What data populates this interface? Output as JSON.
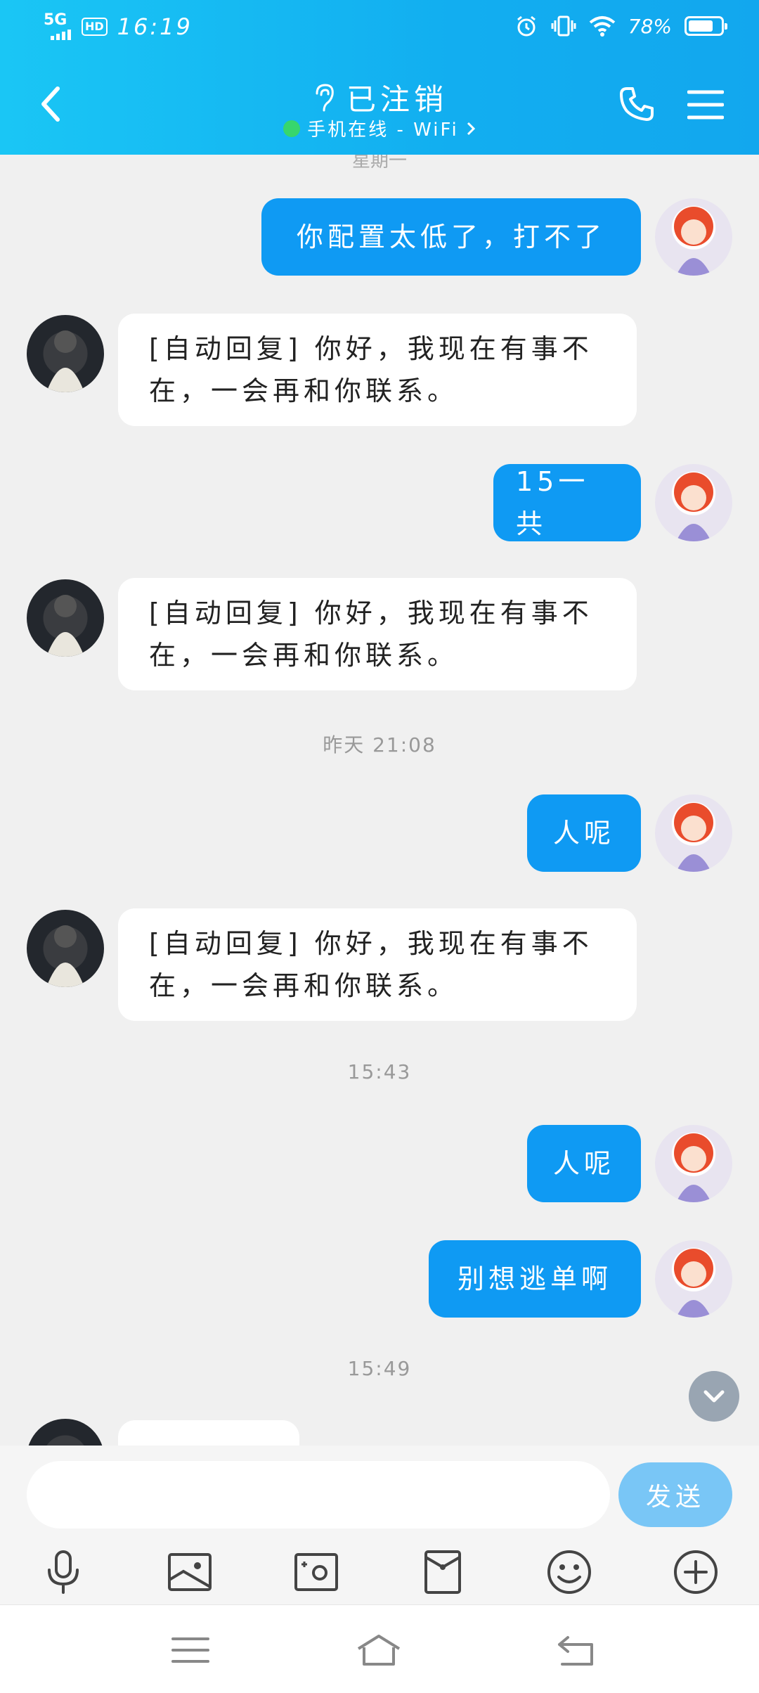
{
  "status_bar": {
    "network": "5G",
    "hd": "HD",
    "time": "16:19",
    "battery": "78%",
    "battery_level": 0.78
  },
  "header": {
    "title": "已注销",
    "subtitle": "手机在线 - WiFi"
  },
  "chat": {
    "partial_timestamp": "星期一",
    "messages": [
      {
        "sender": "me",
        "text": "你配置太低了，打不了"
      },
      {
        "sender": "other",
        "text": "[自动回复] 你好，我现在有事不在，一会再和你联系。"
      },
      {
        "sender": "me",
        "text": "15一共"
      },
      {
        "sender": "other",
        "text": "[自动回复] 你好，我现在有事不在，一会再和你联系。"
      },
      {
        "type": "timestamp",
        "text": "昨天 21:08"
      },
      {
        "sender": "me",
        "text": "人呢"
      },
      {
        "sender": "other",
        "text": "[自动回复] 你好，我现在有事不在，一会再和你联系。"
      },
      {
        "type": "timestamp",
        "text": "15:43"
      },
      {
        "sender": "me",
        "text": "人呢"
      },
      {
        "sender": "me",
        "text": "别想逃单啊"
      },
      {
        "type": "timestamp",
        "text": "15:49"
      }
    ]
  },
  "input": {
    "placeholder": "",
    "send_label": "发送"
  },
  "toolbar": [
    "mic-icon",
    "photo-icon",
    "camera-icon",
    "red-packet-icon",
    "emoji-icon",
    "plus-icon"
  ],
  "colors": {
    "header_bg": "#12aef0",
    "my_bubble": "#0f9af3",
    "other_bubble": "#ffffff",
    "send_button": "#79c6f6",
    "online_dot": "#37d66d"
  }
}
